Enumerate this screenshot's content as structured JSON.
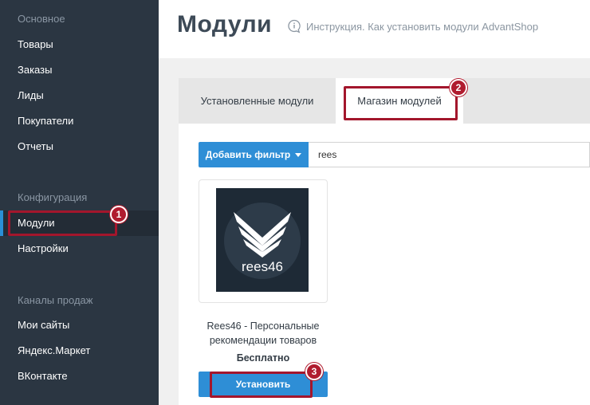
{
  "sidebar": {
    "sections": [
      {
        "label": "Основное"
      },
      {
        "label": "Конфигурация"
      },
      {
        "label": "Каналы продаж"
      }
    ],
    "items": [
      {
        "label": "Товары"
      },
      {
        "label": "Заказы"
      },
      {
        "label": "Лиды"
      },
      {
        "label": "Покупатели"
      },
      {
        "label": "Отчеты"
      },
      {
        "label": "Модули",
        "active": true
      },
      {
        "label": "Настройки"
      },
      {
        "label": "Мои сайты"
      },
      {
        "label": "Яндекс.Маркет"
      },
      {
        "label": "ВКонтакте"
      }
    ]
  },
  "header": {
    "title": "Модули",
    "help_link": "Инструкция. Как установить модули AdvantShop"
  },
  "tabs": [
    {
      "label": "Установленные модули",
      "active": false
    },
    {
      "label": "Магазин модулей",
      "active": true
    }
  ],
  "filter": {
    "button_label": "Добавить фильтр",
    "search_value": "rees"
  },
  "module": {
    "logo_text": "rees46",
    "name": "Rees46 - Персональные рекомендации товаров",
    "price": "Бесплатно",
    "install_label": "Установить"
  },
  "annotations": [
    {
      "number": "1"
    },
    {
      "number": "2"
    },
    {
      "number": "3"
    }
  ],
  "colors": {
    "sidebar_bg": "#2b3642",
    "accent_blue": "#2e8ed6",
    "annotation_red": "#a3162c"
  }
}
